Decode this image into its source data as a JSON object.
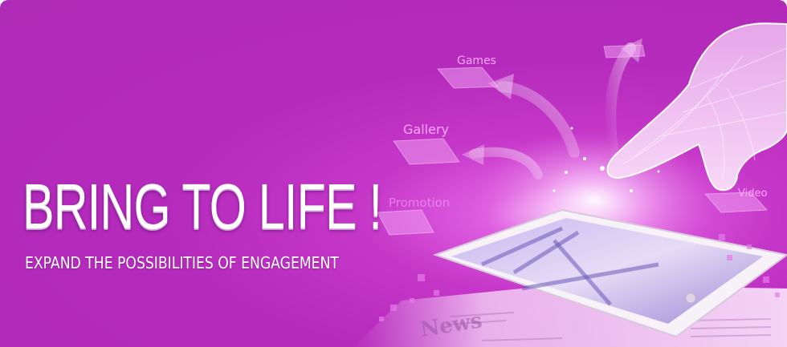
{
  "banner": {
    "headline": "BRING TO LIFE !",
    "subheadline": "EXPAND THE POSSIBILITIES OF ENGAGEMENT",
    "menu_labels": {
      "games": "Games",
      "gallery": "Gallery",
      "promotion": "Promotion",
      "video": "Video"
    },
    "newspaper_text": "News",
    "colors": {
      "background": "#b52bbc",
      "glow": "#f6b8f7",
      "text": "#ffffff",
      "label": "#ffafff"
    },
    "icons": [
      "tablet-icon",
      "hand-icon",
      "newspaper-icon",
      "curved-arrow-icon",
      "grid-tile-icon"
    ]
  }
}
